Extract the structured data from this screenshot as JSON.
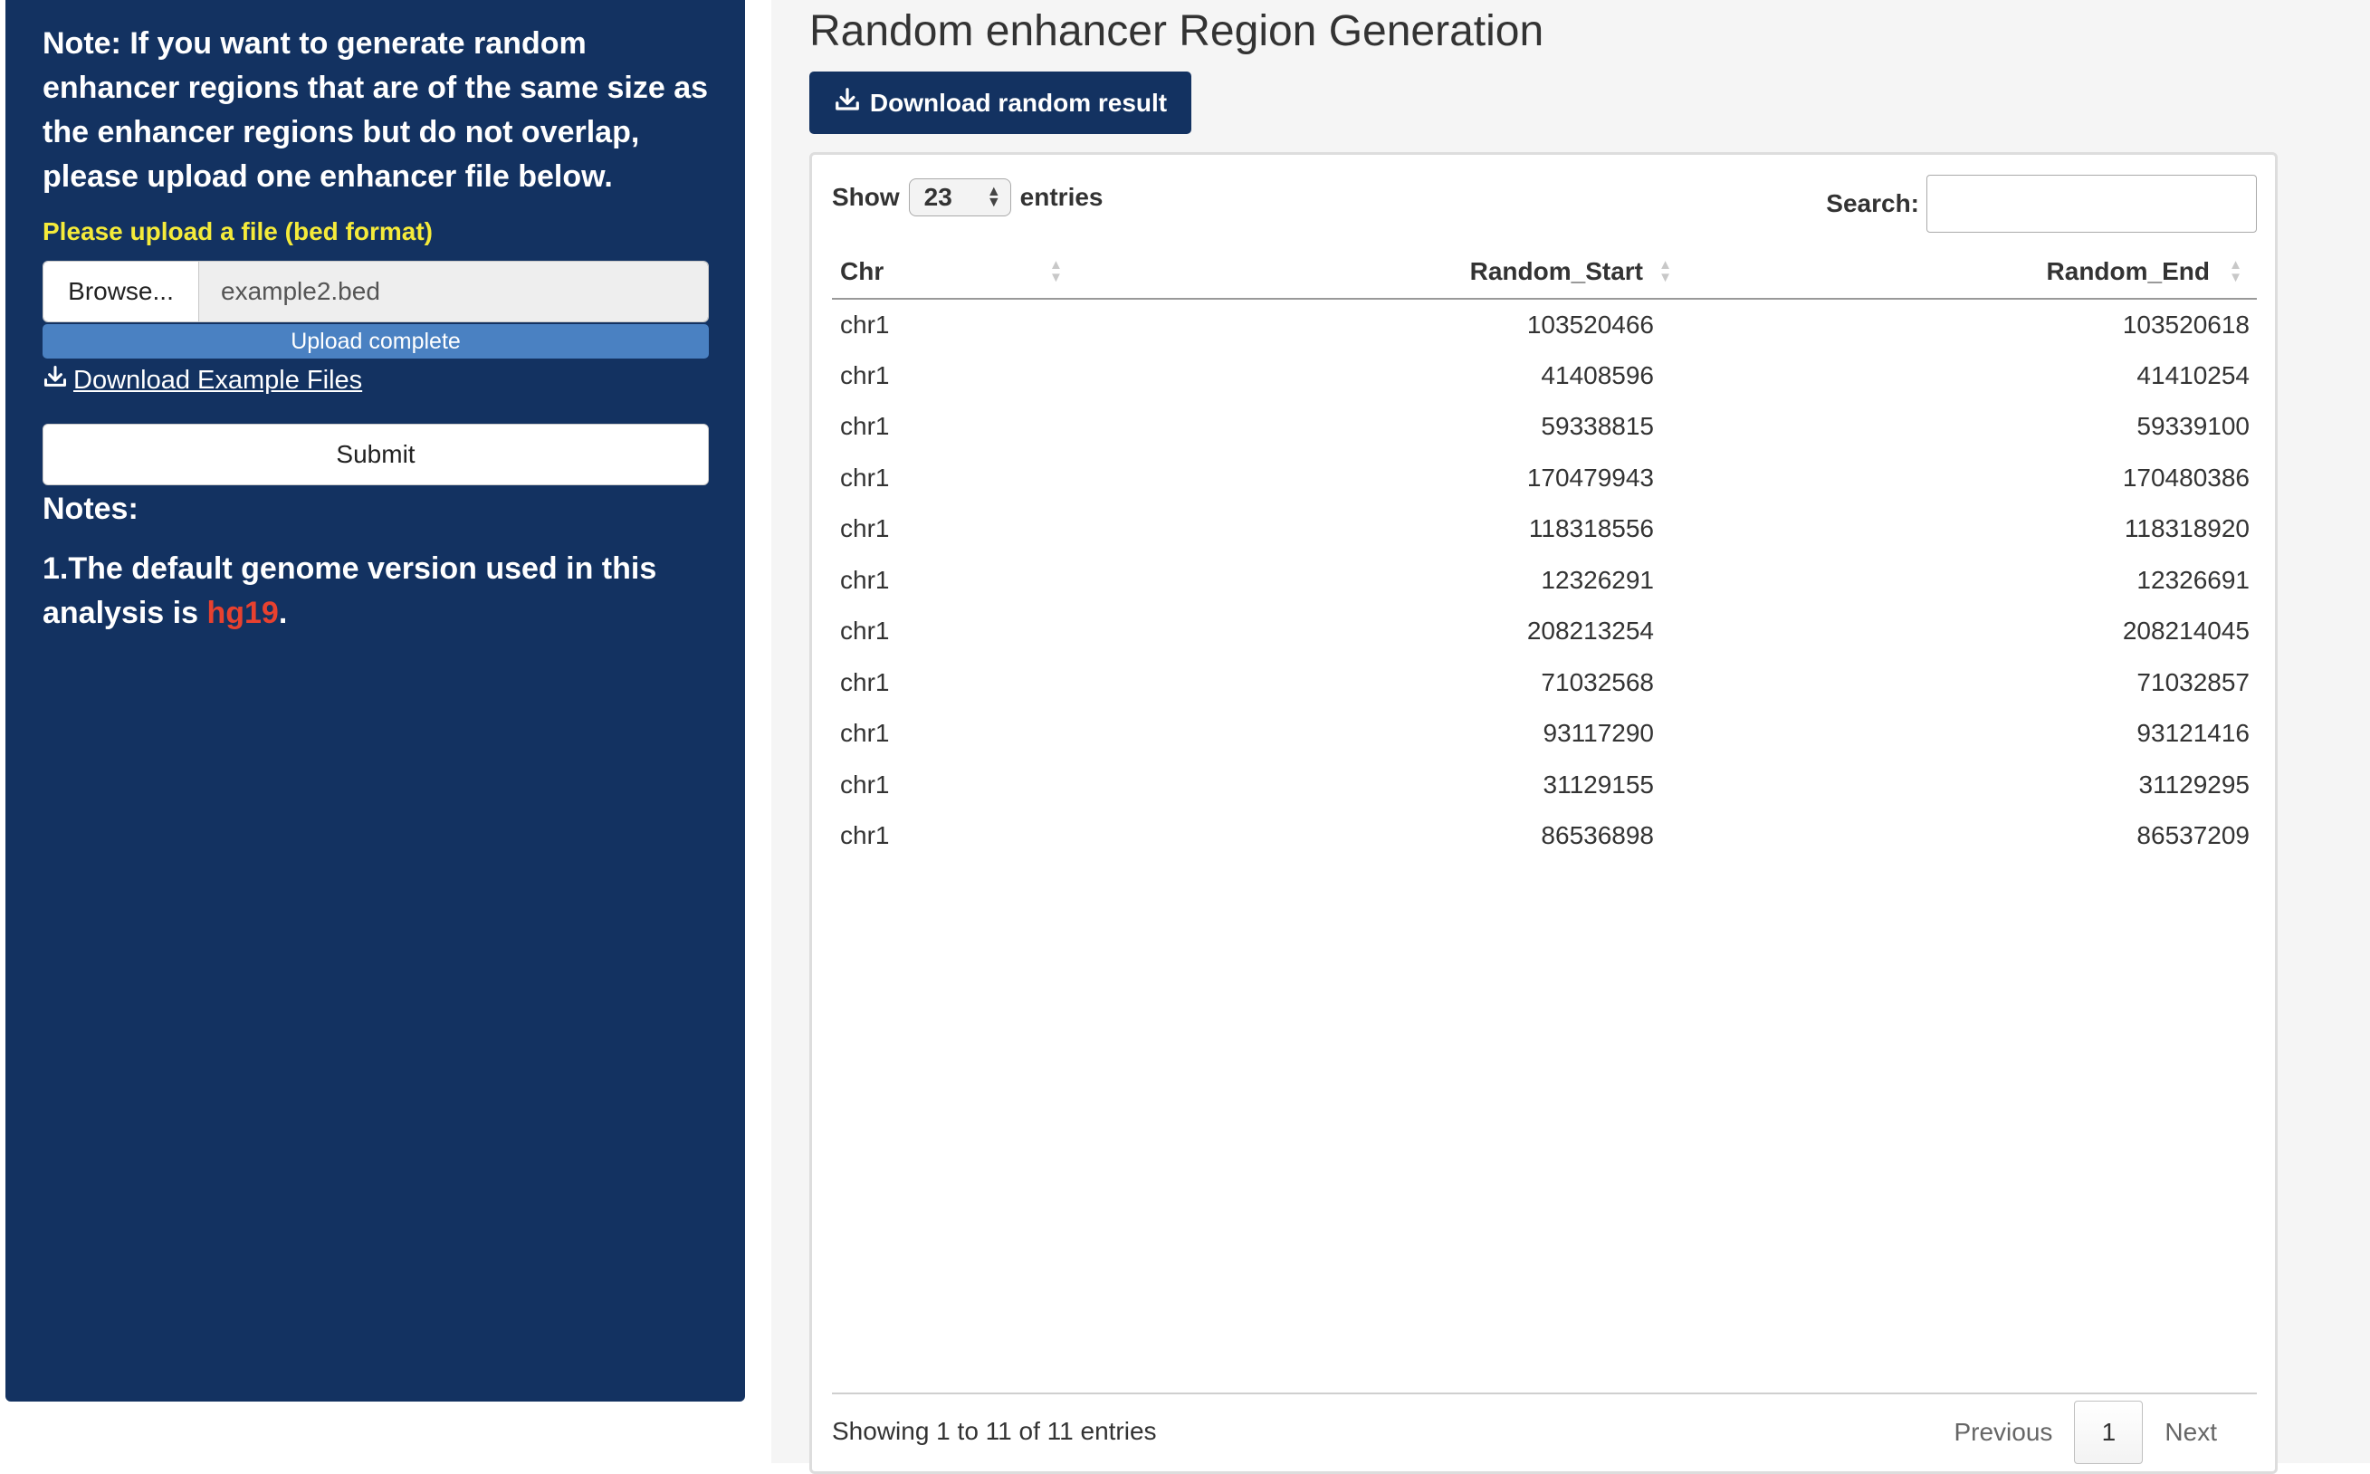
{
  "sidebar": {
    "note": "Note: If you want to generate random enhancer regions that are of the same size as the enhancer regions but do not overlap, please upload one enhancer file below.",
    "upload_label": "Please upload a file (bed format)",
    "browse_label": "Browse...",
    "file_name": "example2.bed",
    "upload_status": "Upload complete",
    "upload_progress": 1.0,
    "download_example_label": "Download Example Files",
    "submit_label": "Submit",
    "notes_heading": "Notes:",
    "notes_item_prefix": "1.The default genome version used in this analysis is ",
    "notes_item_genome": "hg19",
    "notes_item_suffix": ".",
    "background_color": "#133261",
    "label_color": "#f5eb3a",
    "highlight_color": "#e8412f"
  },
  "main": {
    "title": "Random enhancer Region Generation",
    "download_random_label": "Download random result",
    "show_label": "Show",
    "entries_value": "23",
    "entries_label": "entries",
    "search_label": "Search:",
    "search_value": "",
    "columns": [
      "Chr",
      "Random_Start",
      "Random_End"
    ],
    "rows": [
      [
        "chr1",
        "103520466",
        "103520618"
      ],
      [
        "chr1",
        "41408596",
        "41410254"
      ],
      [
        "chr1",
        "59338815",
        "59339100"
      ],
      [
        "chr1",
        "170479943",
        "170480386"
      ],
      [
        "chr1",
        "118318556",
        "118318920"
      ],
      [
        "chr1",
        "12326291",
        "12326691"
      ],
      [
        "chr1",
        "208213254",
        "208214045"
      ],
      [
        "chr1",
        "71032568",
        "71032857"
      ],
      [
        "chr1",
        "93117290",
        "93121416"
      ],
      [
        "chr1",
        "31129155",
        "31129295"
      ],
      [
        "chr1",
        "86536898",
        "86537209"
      ]
    ],
    "info": "Showing 1 to 11 of 11 entries",
    "pagination": {
      "previous": "Previous",
      "current_page": "1",
      "next": "Next"
    }
  }
}
